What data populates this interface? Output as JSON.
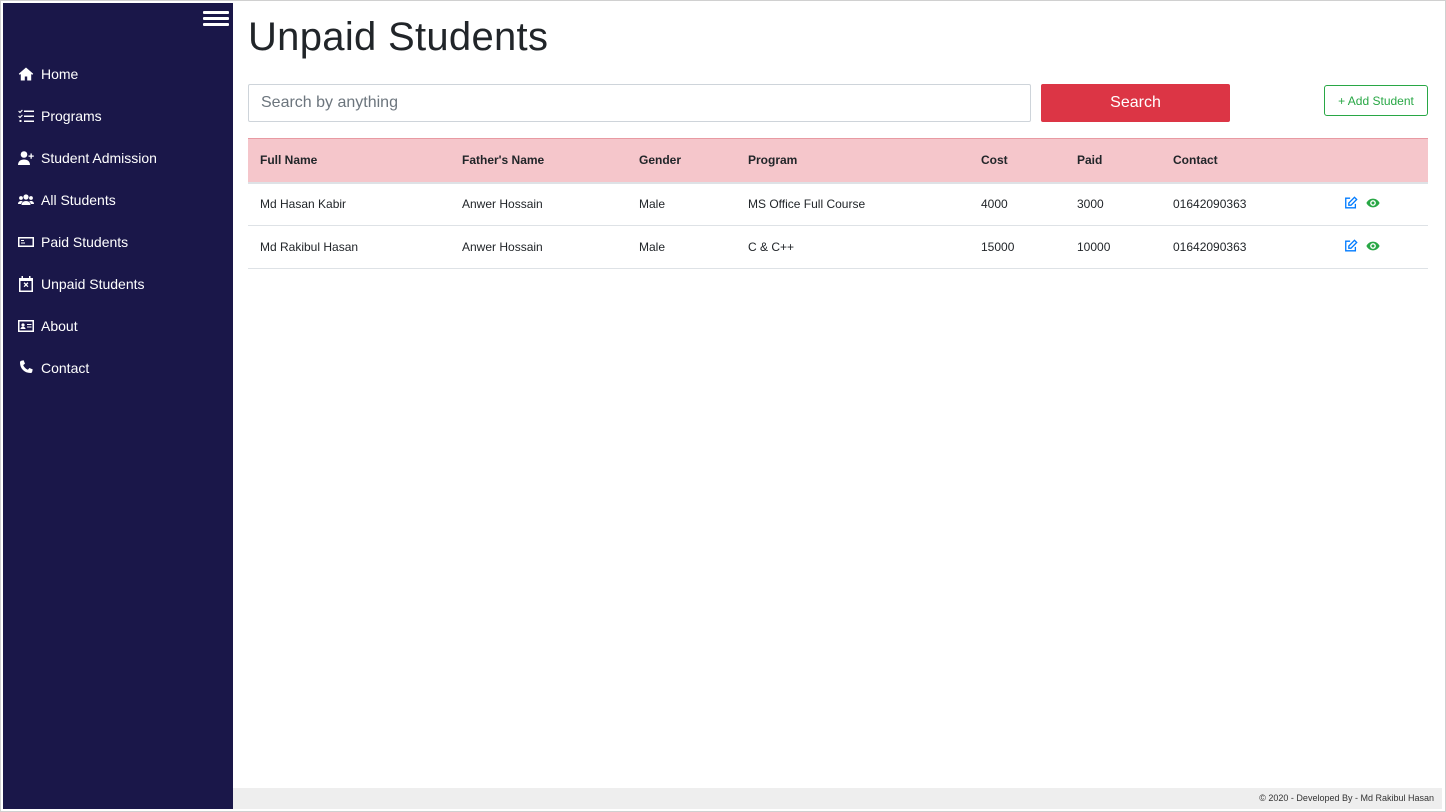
{
  "sidebar": {
    "items": [
      {
        "label": "Home",
        "icon": "home-icon"
      },
      {
        "label": "Programs",
        "icon": "list-check-icon"
      },
      {
        "label": "Student Admission",
        "icon": "user-plus-icon"
      },
      {
        "label": "All Students",
        "icon": "users-icon"
      },
      {
        "label": "Paid Students",
        "icon": "money-bill-icon"
      },
      {
        "label": "Unpaid Students",
        "icon": "calendar-x-icon"
      },
      {
        "label": "About",
        "icon": "id-card-icon"
      },
      {
        "label": "Contact",
        "icon": "phone-icon"
      }
    ]
  },
  "main": {
    "title": "Unpaid Students",
    "search": {
      "placeholder": "Search by anything",
      "button_label": "Search"
    },
    "add_button_label": "+ Add Student",
    "table": {
      "columns": [
        "Full Name",
        "Father's Name",
        "Gender",
        "Program",
        "Cost",
        "Paid",
        "Contact"
      ],
      "rows": [
        [
          "Md Hasan Kabir",
          "Anwer Hossain",
          "Male",
          "MS Office Full Course",
          "4000",
          "3000",
          "01642090363"
        ],
        [
          "Md Rakibul Hasan",
          "Anwer Hossain",
          "Male",
          "C & C++",
          "15000",
          "10000",
          "01642090363"
        ]
      ]
    }
  },
  "footer": {
    "text": "© 2020 - Developed By - Md Rakibul Hasan"
  },
  "colors": {
    "sidebar_bg": "#1a1749",
    "header_row_bg": "#f5c6cb",
    "search_button": "#dc3545",
    "add_button": "#28a745",
    "edit_icon": "#007bff",
    "view_icon": "#28a745"
  }
}
